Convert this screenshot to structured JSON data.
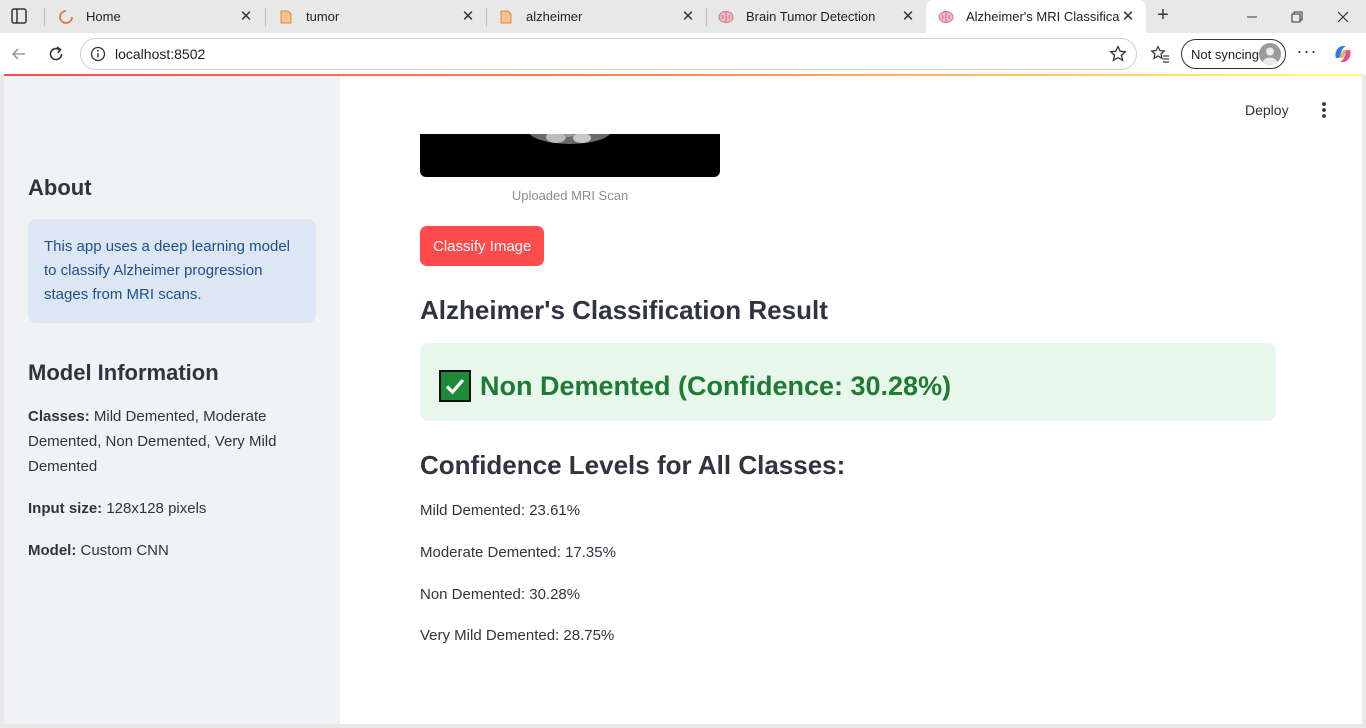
{
  "browser": {
    "tabs": [
      {
        "title": "Home",
        "icon": "streamlit-loading-icon",
        "active": false
      },
      {
        "title": "tumor",
        "icon": "document-icon",
        "active": false
      },
      {
        "title": "alzheimer",
        "icon": "document-icon",
        "active": false
      },
      {
        "title": "Brain Tumor Detection",
        "icon": "brain-icon",
        "active": false
      },
      {
        "title": "Alzheimer's MRI Classification",
        "icon": "brain-icon",
        "active": true
      }
    ],
    "url": "localhost:8502",
    "sync_label": "Not syncing"
  },
  "sidebar": {
    "about_heading": "About",
    "about_text": "This app uses a deep learning model to classify Alzheimer progression stages from MRI scans.",
    "model_heading": "Model Information",
    "classes_label": "Classes:",
    "classes_value": "Mild Demented, Moderate Demented, Non Demented, Very Mild Demented",
    "input_label": "Input size:",
    "input_value": "128x128 pixels",
    "model_label": "Model:",
    "model_value": "Custom CNN"
  },
  "main": {
    "deploy_label": "Deploy",
    "image_caption": "Uploaded MRI Scan",
    "classify_button": "Classify Image",
    "result_heading": "Alzheimer's Classification Result",
    "result_text": "Non Demented (Confidence: 30.28%)",
    "confidence_heading": "Confidence Levels for All Classes:",
    "confidences": [
      "Mild Demented: 23.61%",
      "Moderate Demented: 17.35%",
      "Non Demented: 30.28%",
      "Very Mild Demented: 28.75%"
    ]
  },
  "colors": {
    "primary": "#ff4b4b",
    "success_bg": "#e8f7ec",
    "success_text": "#1f7a33",
    "info_bg": "#dde7f3",
    "info_text": "#1d4f8c",
    "sidebar_bg": "#f0f2f6"
  }
}
